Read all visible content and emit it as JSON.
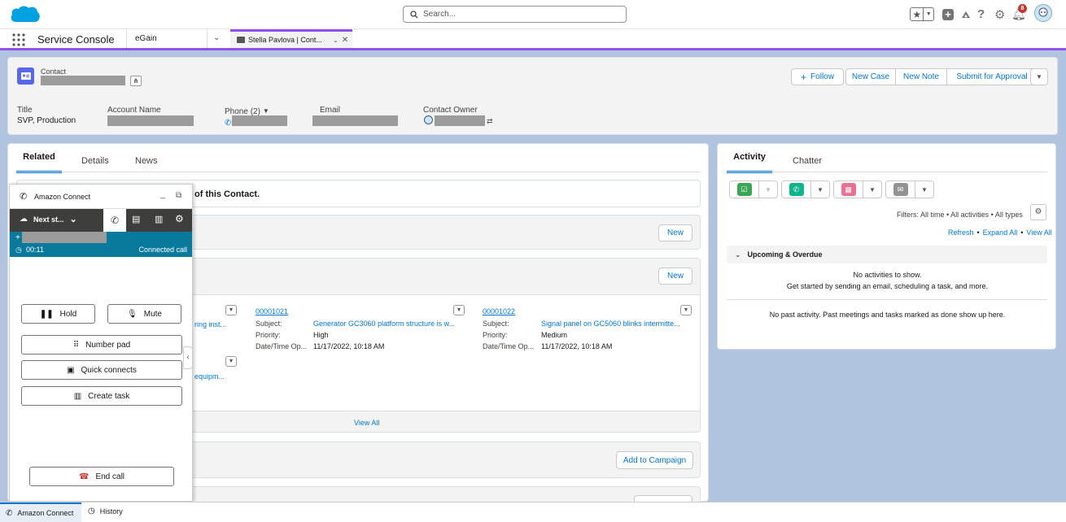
{
  "header": {
    "search_placeholder": "Search...",
    "notification_count": "8"
  },
  "nav": {
    "app_name": "Service Console",
    "tabs": [
      {
        "label": "eGain"
      },
      {
        "label": "Stella Pavlova | Cont..."
      }
    ]
  },
  "record": {
    "object_label": "Contact",
    "actions": {
      "follow": "Follow",
      "new_case": "New Case",
      "new_note": "New Note",
      "submit": "Submit for Approval"
    },
    "fields": {
      "title_label": "Title",
      "title_value": "SVP, Production",
      "account_label": "Account Name",
      "phone_label": "Phone (2)",
      "email_label": "Email",
      "owner_label": "Contact Owner"
    }
  },
  "main_tabs": {
    "related": "Related",
    "details": "Details",
    "news": "News"
  },
  "related": {
    "notice_text": "of this Contact.",
    "new_label_1": "New",
    "new_label_2": "New",
    "cases": [
      {
        "number": "00001021",
        "subject_label": "Subject:",
        "subject": "Generator GC3060 platform structure is w...",
        "priority_label": "Priority:",
        "priority": "High",
        "date_label": "Date/Time Op...",
        "date": "11/17/2022, 10:18 AM"
      },
      {
        "number": "00001022",
        "subject_label": "Subject:",
        "subject": "Signal panel on GC5060 blinks intermitte...",
        "priority_label": "Priority:",
        "priority": "Medium",
        "date_label": "Date/Time Op...",
        "date": "11/17/2022, 10:18 AM"
      }
    ],
    "partial_1": "ring inst...",
    "partial_2": "equipm...",
    "view_all": "View All",
    "add_campaign": "Add to Campaign"
  },
  "activity": {
    "tab_activity": "Activity",
    "tab_chatter": "Chatter",
    "filters": "Filters: All time • All activities • All types",
    "refresh": "Refresh",
    "expand_all": "Expand All",
    "view_all": "View All",
    "upcoming_title": "Upcoming & Overdue",
    "no_activities": "No activities to show.",
    "get_started": "Get started by sending an email, scheduling a task, and more.",
    "no_past": "No past activity. Past meetings and tasks marked as done show up here."
  },
  "connect": {
    "title": "Amazon Connect",
    "status": "Next st...",
    "phone_prefix": "+",
    "timer": "00:11",
    "call_state": "Connected call",
    "hold": "Hold",
    "mute": "Mute",
    "number_pad": "Number pad",
    "quick_connects": "Quick connects",
    "create_task": "Create task",
    "end_call": "End call"
  },
  "utility_bar": {
    "amazon_connect": "Amazon Connect",
    "history": "History"
  },
  "colors": {
    "brand_blue": "#0176d3",
    "connect_teal": "#0a7a9c",
    "connect_dark": "#3e3e3c",
    "end_call_red": "#c23934",
    "bg_blue": "#b0c4df",
    "tab_accent": "#9050e9"
  }
}
